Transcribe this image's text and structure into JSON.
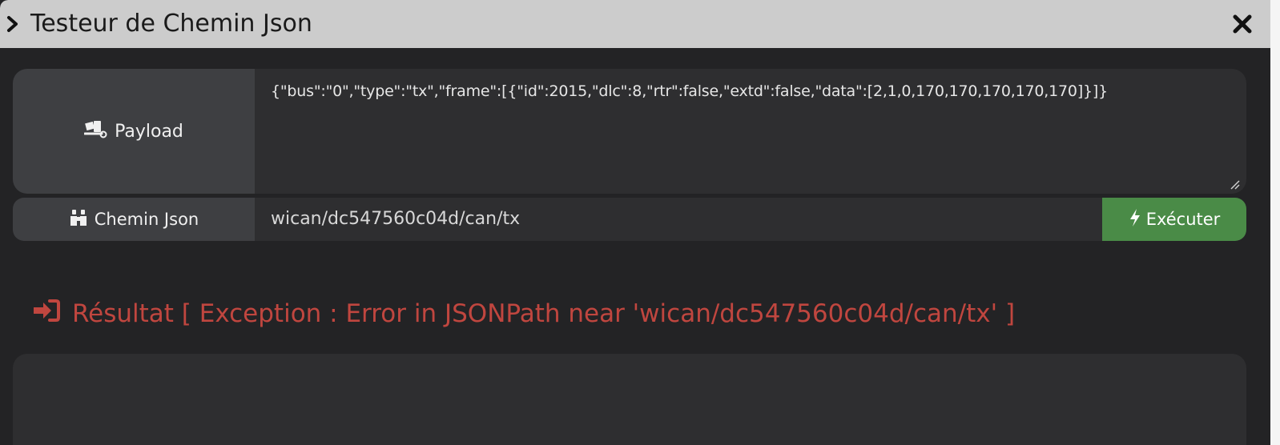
{
  "window": {
    "title": "Testeur de Chemin Json"
  },
  "icons": {
    "title_toggle": "chevron-right-icon",
    "close": "close-icon",
    "payload": "truck-loading-icon",
    "path": "binoculars-icon",
    "execute": "bolt-icon",
    "result": "sign-in-icon"
  },
  "payload": {
    "label": "Payload",
    "value": "{\"bus\":\"0\",\"type\":\"tx\",\"frame\":[{\"id\":2015,\"dlc\":8,\"rtr\":false,\"extd\":false,\"data\":[2,1,0,170,170,170,170,170]}]}"
  },
  "path": {
    "label": "Chemin Json",
    "value": "wican/dc547560c04d/can/tx"
  },
  "execute": {
    "label": "Exécuter"
  },
  "result": {
    "heading": "Résultat [ Exception : Error in JSONPath near 'wican/dc547560c04d/can/tx' ]",
    "output": ""
  },
  "colors": {
    "titlebar": "#cccccc",
    "background": "#232325",
    "label_bg": "#3e3f42",
    "field_bg": "#2e2e30",
    "execute_green": "#4a8b47",
    "error_red": "#c0463f"
  }
}
